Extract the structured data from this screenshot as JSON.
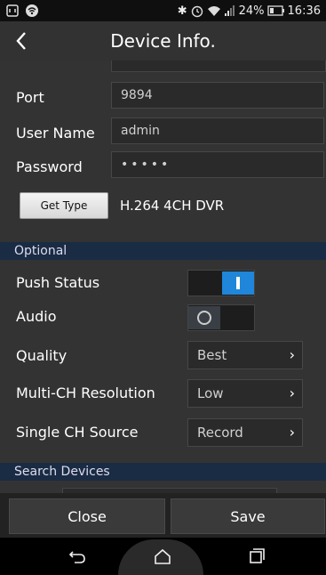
{
  "status": {
    "battery_percent": "24%",
    "time": "16:36"
  },
  "header": {
    "title": "Device Info."
  },
  "form": {
    "port_label": "Port",
    "port_value": "9894",
    "username_label": "User Name",
    "username_value": "admin",
    "password_label": "Password",
    "password_value": "•••••",
    "get_type_label": "Get Type",
    "type_value": "H.264 4CH DVR"
  },
  "optional": {
    "section_label": "Optional",
    "push_status_label": "Push Status",
    "push_status_on": true,
    "audio_label": "Audio",
    "audio_on": false,
    "quality_label": "Quality",
    "quality_value": "Best",
    "multi_ch_label": "Multi-CH Resolution",
    "multi_ch_value": "Low",
    "single_ch_label": "Single CH Source",
    "single_ch_value": "Record"
  },
  "search": {
    "section_label": "Search Devices"
  },
  "footer": {
    "close_label": "Close",
    "save_label": "Save"
  },
  "colors": {
    "accent": "#1f86d9",
    "section_bg": "#1a2b44"
  }
}
